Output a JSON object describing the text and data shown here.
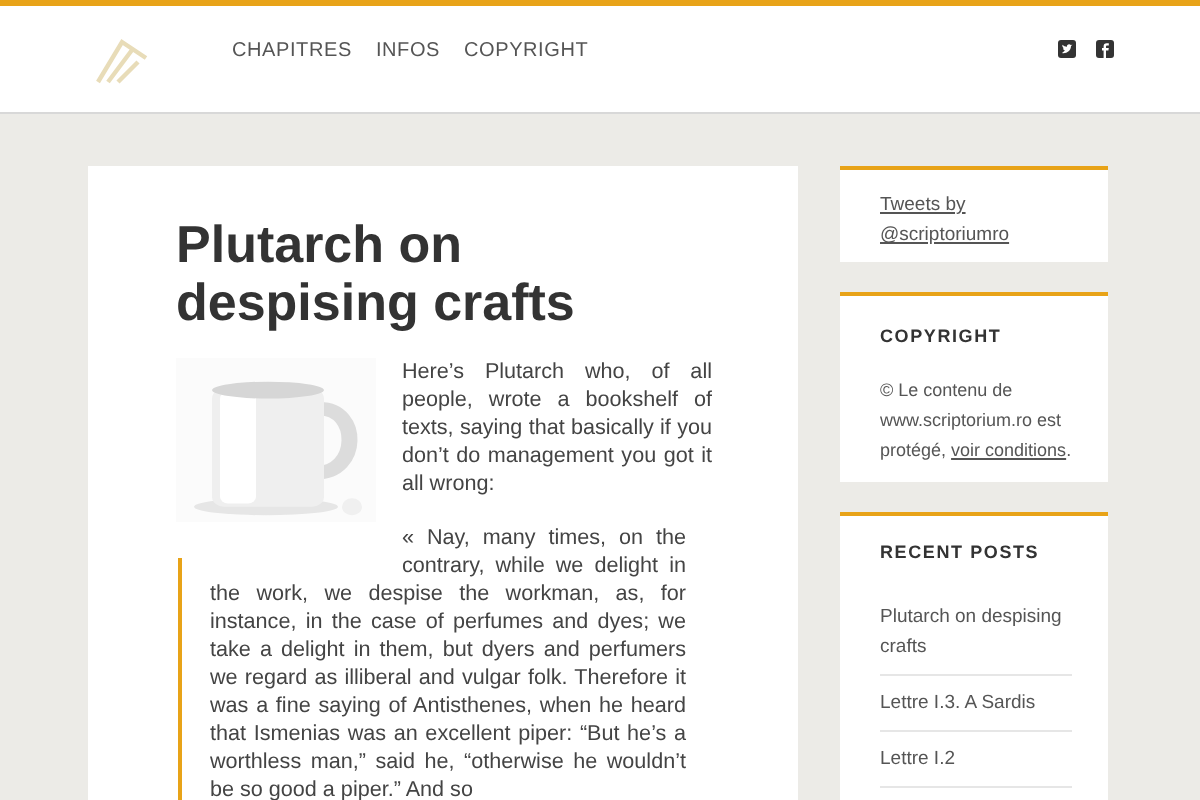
{
  "nav": [
    "CHAPITRES",
    "INFOS",
    "COPYRIGHT"
  ],
  "post": {
    "title": "Plutarch on despising crafts",
    "intro": "Here’s Plutarch who, of all people, wrote a bookshelf of texts, saying that basically if you don’t do management you got it all wrong:",
    "quote": "« Nay, many times, on the contrary, while we delight in the work, we despise the workman, as, for instance, in the case of perfumes and dyes; we take a delight in them, but dyers and perfumers we regard as illiberal and vulgar folk. Therefore it was a fine saying of Antisthenes, when he heard that Ismenias was an excellent piper: “But he’s a worthless man,” said he, “otherwise he wouldn’t be so good a piper.” And so"
  },
  "sidebar": {
    "tweets_link": "Tweets by @scriptoriumro",
    "copyright": {
      "title": "COPYRIGHT",
      "text": "© Le contenu de www.scriptorium.ro est protégé, ",
      "link": "voir conditions",
      "end": "."
    },
    "recent": {
      "title": "RECENT POSTS",
      "items": [
        "Plutarch on despising crafts",
        "Lettre I.3. A Sardis",
        "Lettre I.2"
      ]
    }
  }
}
